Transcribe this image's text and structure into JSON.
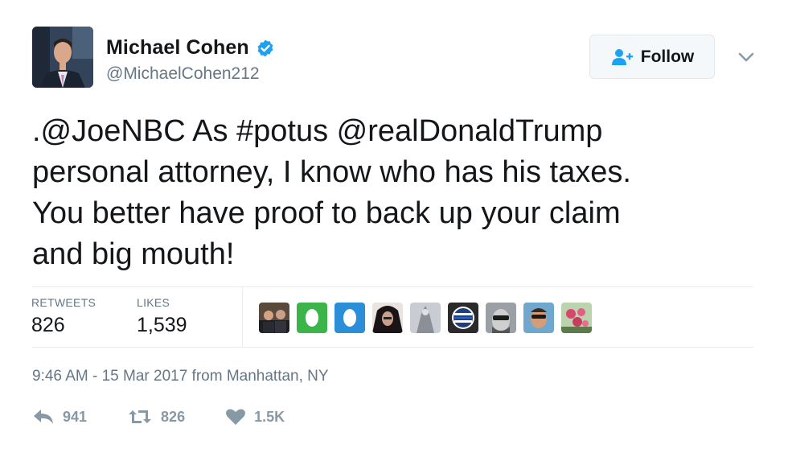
{
  "user": {
    "name": "Michael Cohen",
    "handle": "@MichaelCohen212",
    "verified": true
  },
  "follow_button": {
    "label": "Follow",
    "icon": "follow-user-icon"
  },
  "tweet": {
    "text": ".@JoeNBC As #potus @realDonaldTrump\npersonal attorney, I know who has his taxes.\nYou better have proof to back up your claim\nand big mouth!"
  },
  "stats": {
    "retweets_label": "RETWEETS",
    "retweets_value": "826",
    "likes_label": "LIKES",
    "likes_value": "1,539"
  },
  "likers": [
    {
      "icon": "liker-avatar-1"
    },
    {
      "icon": "liker-avatar-2"
    },
    {
      "icon": "liker-avatar-3"
    },
    {
      "icon": "liker-avatar-4"
    },
    {
      "icon": "liker-avatar-5"
    },
    {
      "icon": "liker-avatar-6"
    },
    {
      "icon": "liker-avatar-7"
    },
    {
      "icon": "liker-avatar-8"
    },
    {
      "icon": "liker-avatar-9"
    }
  ],
  "timestamp": "9:46 AM - 15 Mar 2017 from Manhattan, NY",
  "actions": {
    "reply_count": "941",
    "retweet_count": "826",
    "like_count": "1.5K"
  },
  "colors": {
    "verified_blue": "#1da1f2",
    "secondary_text": "#657786",
    "action_gray": "#8899a6"
  }
}
